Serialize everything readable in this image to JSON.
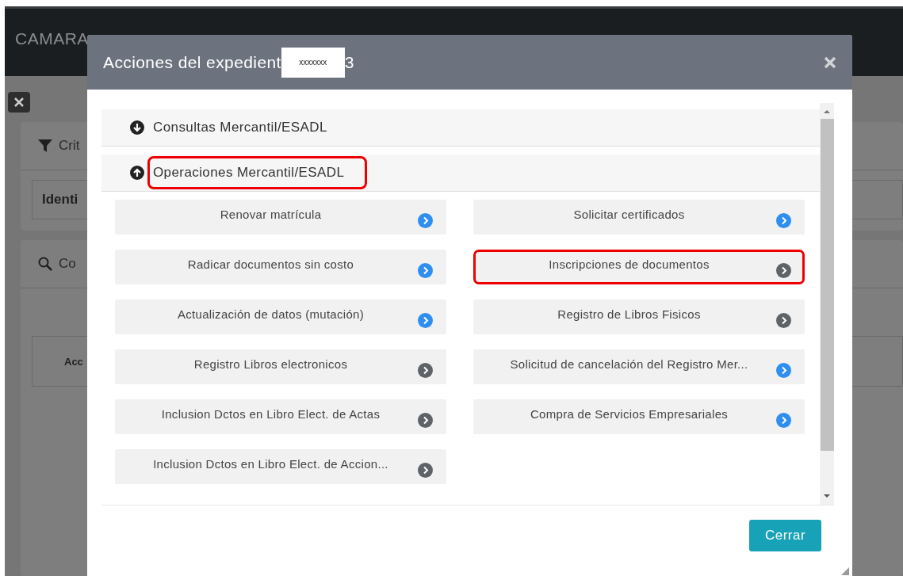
{
  "background": {
    "brand": "CAMARA",
    "filter_card": "Crit",
    "field_label": "Identi",
    "search_card": "Co",
    "table_header": "Acc"
  },
  "dialog": {
    "title": "Acciones del expedient",
    "redacted": "xxxxxxx",
    "title_suffix": "3",
    "sections": [
      {
        "label": "Consultas Mercantil/ESADL",
        "expanded": false,
        "highlighted": false
      },
      {
        "label": "Operaciones Mercantil/ESADL",
        "expanded": true,
        "highlighted": true,
        "items": [
          {
            "label": "Renovar matrícula",
            "color": "#2e8ff0",
            "highlighted": false
          },
          {
            "label": "Solicitar certificados",
            "color": "#2e8ff0",
            "highlighted": false
          },
          {
            "label": "Radicar documentos sin costo",
            "color": "#2e8ff0",
            "highlighted": false
          },
          {
            "label": "Inscripciones de documentos",
            "color": "#5f6368",
            "highlighted": true
          },
          {
            "label": "Actualización de datos (mutación)",
            "color": "#2e8ff0",
            "highlighted": false
          },
          {
            "label": "Registro de Libros Fisicos",
            "color": "#5f6368",
            "highlighted": false
          },
          {
            "label": "Registro Libros electronicos",
            "color": "#5f6368",
            "highlighted": false
          },
          {
            "label": "Solicitud de cancelación del Registro Mer...",
            "color": "#2e8ff0",
            "highlighted": false
          },
          {
            "label": "Inclusion Dctos en Libro Elect. de Actas",
            "color": "#5f6368",
            "highlighted": false
          },
          {
            "label": "Compra de Servicios Empresariales",
            "color": "#2e8ff0",
            "highlighted": false
          },
          {
            "label": "Inclusion Dctos en Libro Elect. de Accion...",
            "color": "#5f6368",
            "highlighted": false
          }
        ]
      }
    ],
    "close_button": "Cerrar"
  }
}
